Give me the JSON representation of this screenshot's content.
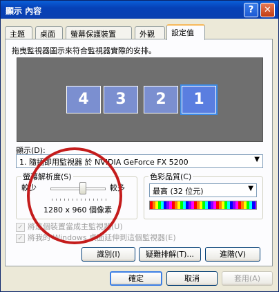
{
  "window": {
    "title": "顯示 內容",
    "help": "?",
    "close": "✕"
  },
  "tabs": [
    {
      "label": "主題"
    },
    {
      "label": "桌面"
    },
    {
      "label": "螢幕保護裝置"
    },
    {
      "label": "外觀"
    },
    {
      "label": "設定值"
    }
  ],
  "settings": {
    "hint": "拖曳監視器圖示來符合監視器實際的安排。",
    "monitors": [
      "4",
      "3",
      "2",
      "1"
    ],
    "display_label": "顯示(D):",
    "display_value": "1. 隨插即用監視器 於 NVIDIA GeForce FX 5200",
    "resolution_group": "螢幕解析度(S)",
    "less": "較少",
    "more": "較多",
    "resolution_value": "1280 x 960 個像素",
    "color_group": "色彩品質(C)",
    "color_value": "最高 (32 位元)",
    "check_primary": "將這個裝置當成主監視器(U)",
    "check_extend": "將我的 Windows 桌面延伸到這個監視器(E)",
    "identify": "識別(I)",
    "troubleshoot": "疑難排解(T)...",
    "advanced": "進階(V)"
  },
  "footer": {
    "ok": "確定",
    "cancel": "取消",
    "apply": "套用(A)"
  }
}
